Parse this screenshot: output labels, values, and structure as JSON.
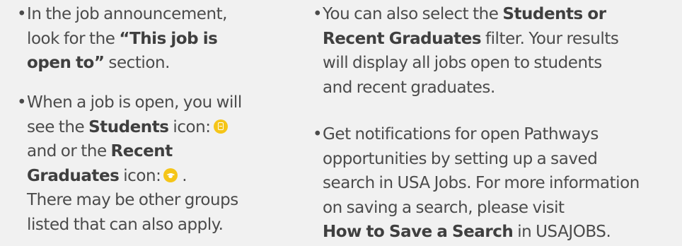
{
  "bullet_symbol": "•",
  "left_column": {
    "item1": {
      "l1": "In the job announcement,",
      "l2_pre": "look for the ",
      "l2_bold": "“This job is",
      "l3_bold": "open to”",
      "l3_post": " section."
    },
    "item2": {
      "l1": "When a job is open, you will",
      "l2_pre": "see the ",
      "l2_bold": "Students",
      "l2_post": " icon:",
      "l3_pre": "and or the ",
      "l3_bold": "Recent",
      "l4_bold": "Graduates",
      "l4_post": " icon:",
      "l4_end": " .",
      "l5": "There may be other groups",
      "l6": "listed that can also apply."
    }
  },
  "right_column": {
    "item1": {
      "l1_pre": "You can also select the ",
      "l1_bold": "Students or",
      "l2_bold": "Recent Graduates",
      "l2_post": " filter. Your results",
      "l3": "will display all jobs open to students",
      "l4": "and recent graduates."
    },
    "item2": {
      "l1": "Get notifications for open Pathways",
      "l2": "opportunities by setting up a saved",
      "l3": "search in USA Jobs. For more information",
      "l4": "on saving a search, please visit",
      "l5_bold": "How to Save a Search",
      "l5_post": " in USAJOBS."
    }
  },
  "icons": {
    "students": "students-book-icon",
    "graduates": "graduation-cap-icon",
    "accent": "#f5c518"
  }
}
